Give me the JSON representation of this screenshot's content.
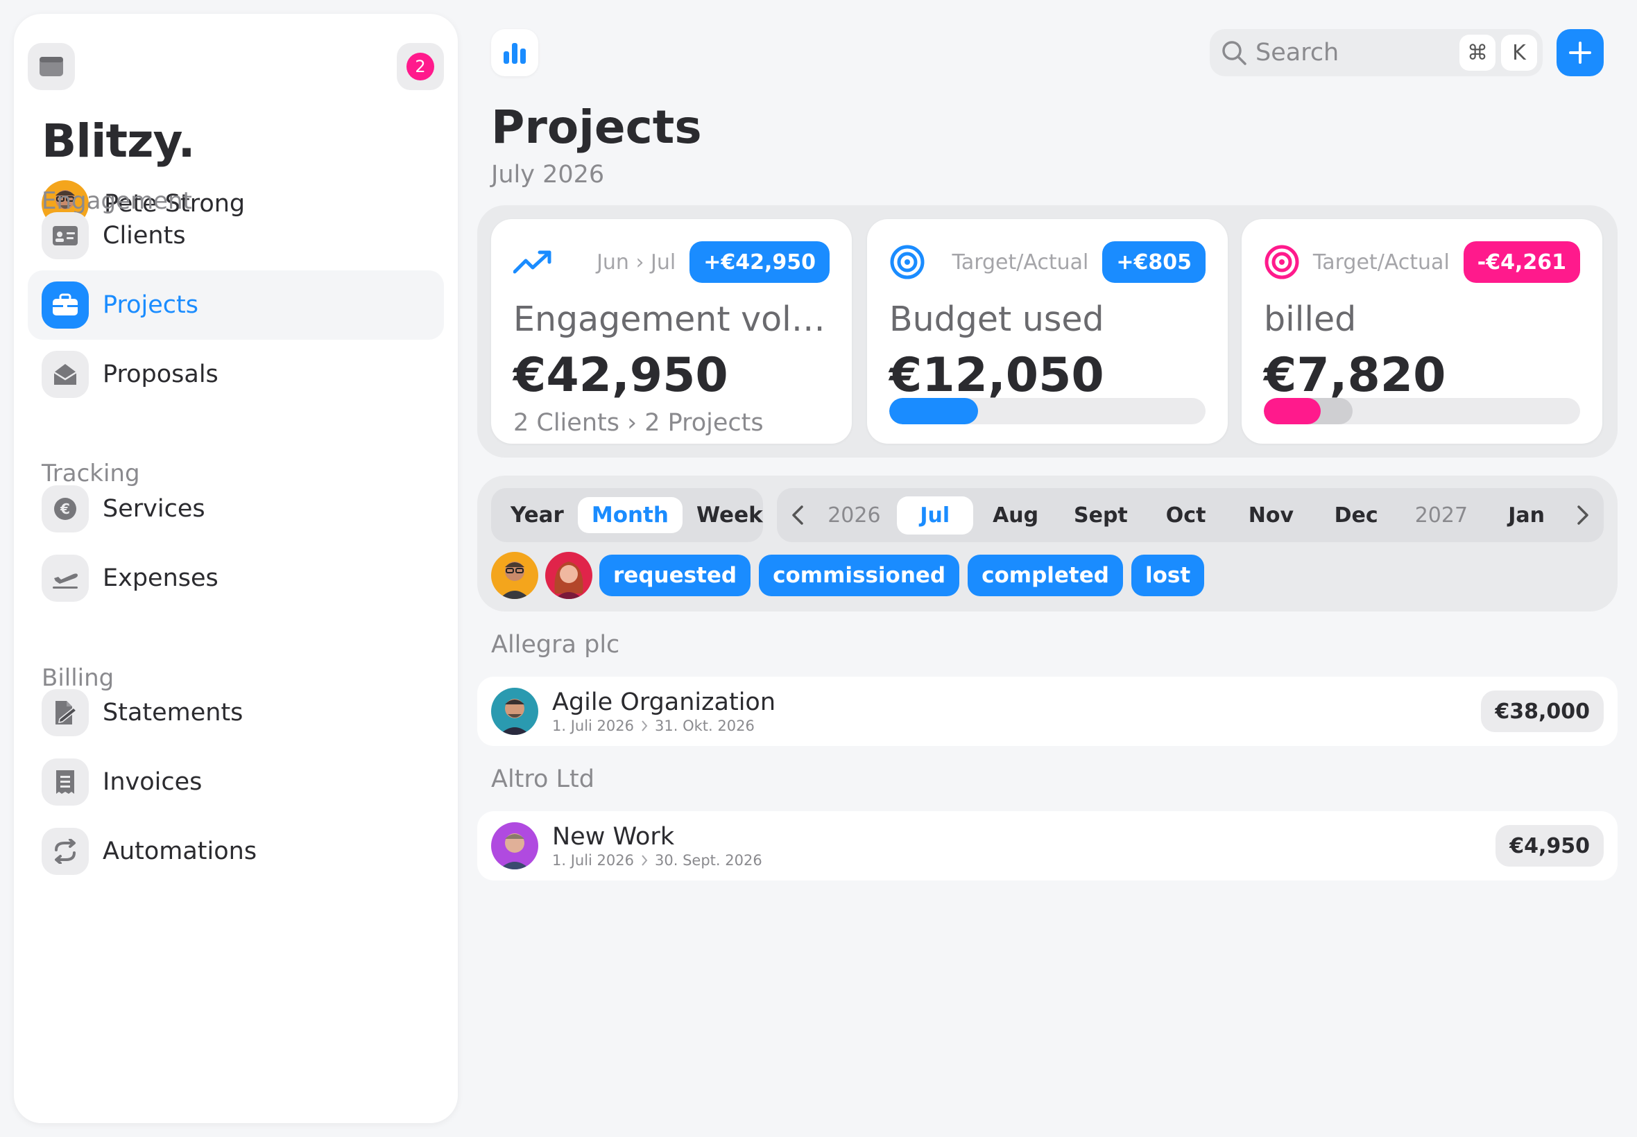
{
  "sidebar": {
    "notification_count": "2",
    "brand": "Blitzy.",
    "user_name": "Pete Strong",
    "sections": [
      {
        "label": "Engagement"
      },
      {
        "label": "Tracking"
      },
      {
        "label": "Billing"
      }
    ],
    "items": [
      {
        "label": "Clients",
        "icon": "id-card-icon"
      },
      {
        "label": "Projects",
        "icon": "briefcase-icon",
        "active": true
      },
      {
        "label": "Proposals",
        "icon": "envelope-open-icon"
      },
      {
        "label": "Services",
        "icon": "euro-coin-icon"
      },
      {
        "label": "Expenses",
        "icon": "plane-departure-icon"
      },
      {
        "label": "Statements",
        "icon": "file-signature-icon"
      },
      {
        "label": "Invoices",
        "icon": "receipt-icon"
      },
      {
        "label": "Automations",
        "icon": "refresh-icon"
      }
    ]
  },
  "header": {
    "search_placeholder": "Search",
    "shortcut_mod": "⌘",
    "shortcut_key": "K"
  },
  "page": {
    "title": "Projects",
    "subtitle": "July 2026"
  },
  "kpis": [
    {
      "range_from": "Jun",
      "range_to": "Jul",
      "badge": "+€42,950",
      "label": "Engagement volu…",
      "value": "€42,950",
      "foot_a": "2 Clients",
      "foot_b": "2 Projects",
      "icon": "trend-up-icon"
    },
    {
      "range": "Target/Actual",
      "badge": "+€805",
      "label": "Budget used",
      "value": "€12,050",
      "progress": 0.28,
      "icon": "target-icon"
    },
    {
      "range": "Target/Actual",
      "badge": "-€4,261",
      "label": "billed",
      "value": "€7,820",
      "progress": 0.18,
      "progress_secondary": 0.28,
      "icon": "target-icon"
    }
  ],
  "filters": {
    "periods": [
      "Year",
      "Month",
      "Week"
    ],
    "active_period": "Month",
    "months": [
      "2026",
      "Jul",
      "Aug",
      "Sept",
      "Oct",
      "Nov",
      "Dec",
      "2027",
      "Jan"
    ],
    "active_month": "Jul",
    "statuses": [
      "requested",
      "commissioned",
      "completed",
      "lost"
    ]
  },
  "groups": [
    {
      "client": "Allegra plc",
      "projects": [
        {
          "title": "Agile Organization",
          "start": "1. Juli 2026",
          "end": "31. Okt. 2026",
          "amount": "€38,000"
        }
      ]
    },
    {
      "client": "Altro Ltd",
      "projects": [
        {
          "title": "New Work",
          "start": "1. Juli 2026",
          "end": "30. Sept. 2026",
          "amount": "€4,950"
        }
      ]
    }
  ],
  "colors": {
    "accent": "#1a8cff",
    "pink": "#ff1a8c",
    "text": "#2b2b2f",
    "muted": "#8a8a8e"
  }
}
